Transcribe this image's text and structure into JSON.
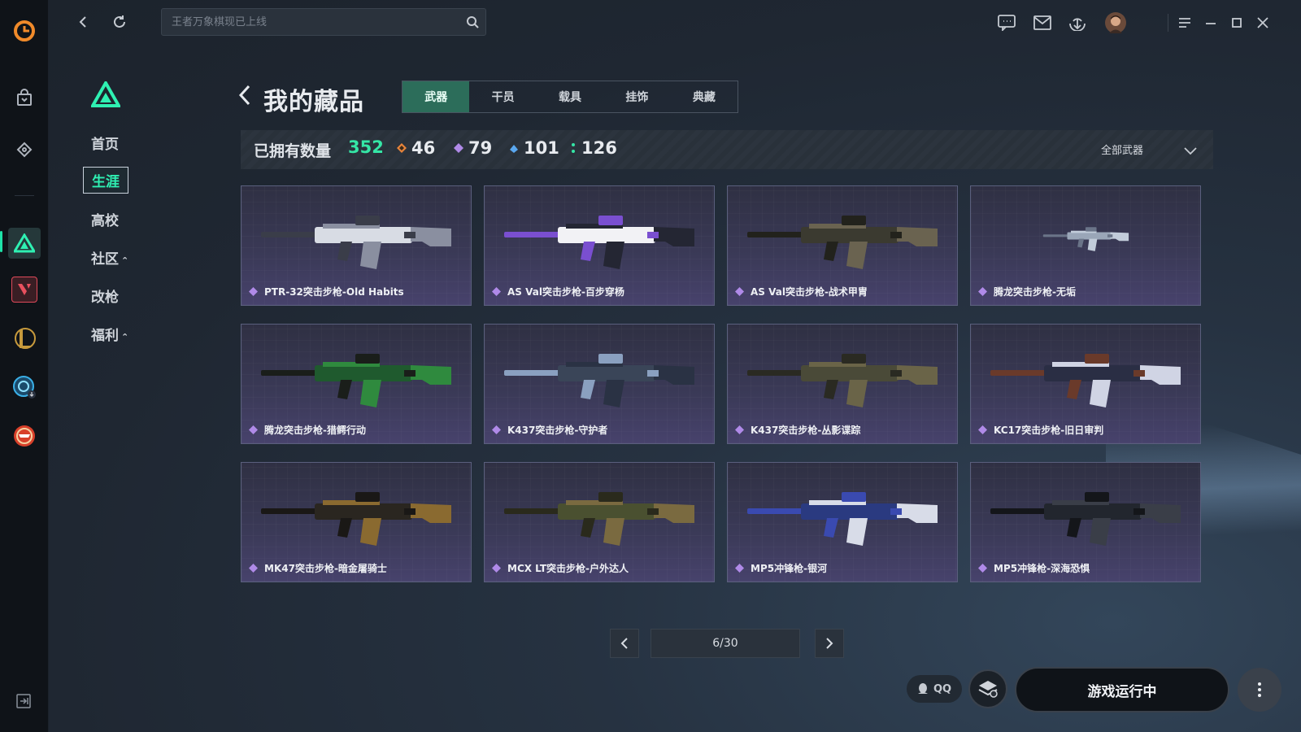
{
  "search": {
    "placeholder": "王者万象棋现已上线"
  },
  "sidebar": {
    "items": [
      {
        "label": "首页"
      },
      {
        "label": "生涯"
      },
      {
        "label": "高校"
      },
      {
        "label": "社区"
      },
      {
        "label": "改枪"
      },
      {
        "label": "福利"
      }
    ],
    "caret": "⌃"
  },
  "page": {
    "title": "我的藏品",
    "tabs": [
      "武器",
      "干员",
      "载具",
      "挂饰",
      "典藏"
    ]
  },
  "stats": {
    "owned_label": "已拥有数量",
    "owned_total": "352",
    "rarities": [
      {
        "count": "46",
        "color": "#e8843a"
      },
      {
        "count": "79",
        "color": "#b08ae8"
      },
      {
        "count": "101",
        "color": "#5aa8f0"
      },
      {
        "count": "126",
        "color": "#35e6a6"
      }
    ],
    "filter": "全部武器"
  },
  "items": [
    {
      "name": "PTR-32突击步枪-Old Habits",
      "palette": [
        "#d8dce4",
        "#8a8fa0",
        "#3a3d49"
      ]
    },
    {
      "name": "AS Val突击步枪-百步穿杨",
      "palette": [
        "#f2f2f5",
        "#242633",
        "#7a4fd0"
      ]
    },
    {
      "name": "AS Val突击步枪-战术甲胄",
      "palette": [
        "#3b3a30",
        "#6a6350",
        "#22221c"
      ]
    },
    {
      "name": "腾龙突击步枪-无垢",
      "palette": [
        "#9aa6b8",
        "#c2ccda",
        "#6a7488"
      ]
    },
    {
      "name": "腾龙突击步枪-猎鳄行动",
      "palette": [
        "#1f5a2e",
        "#2f8a3e",
        "#1a1e1a"
      ]
    },
    {
      "name": "K437突击步枪-守护者",
      "palette": [
        "#3a4558",
        "#2a3244",
        "#8aa0c0"
      ]
    },
    {
      "name": "K437突击步枪-丛影谍踪",
      "palette": [
        "#4a4a38",
        "#6a6448",
        "#2a2a22"
      ]
    },
    {
      "name": "KC17突击步枪-旧日审判",
      "palette": [
        "#2a2e44",
        "#d0d4e4",
        "#6a3a2a"
      ]
    },
    {
      "name": "MK47突击步枪-暗金屠骑士",
      "palette": [
        "#2a2620",
        "#8a6a30",
        "#1a1816"
      ]
    },
    {
      "name": "MCX LT突击步枪-户外达人",
      "palette": [
        "#4a5030",
        "#7a6a40",
        "#2a2a1c"
      ]
    },
    {
      "name": "MP5冲锋枪-银河",
      "palette": [
        "#2a3a80",
        "#d8dce8",
        "#3a4ab0"
      ]
    },
    {
      "name": "MP5冲锋枪-深海恐惧",
      "palette": [
        "#22262e",
        "#3a3e48",
        "#14161a"
      ]
    }
  ],
  "pager": {
    "text": "6/30"
  },
  "footer": {
    "qq_label": "QQ",
    "play_label": "游戏运行中"
  },
  "colors": {
    "accent": "#35e6a6",
    "card_border": "#5a5f7d"
  }
}
